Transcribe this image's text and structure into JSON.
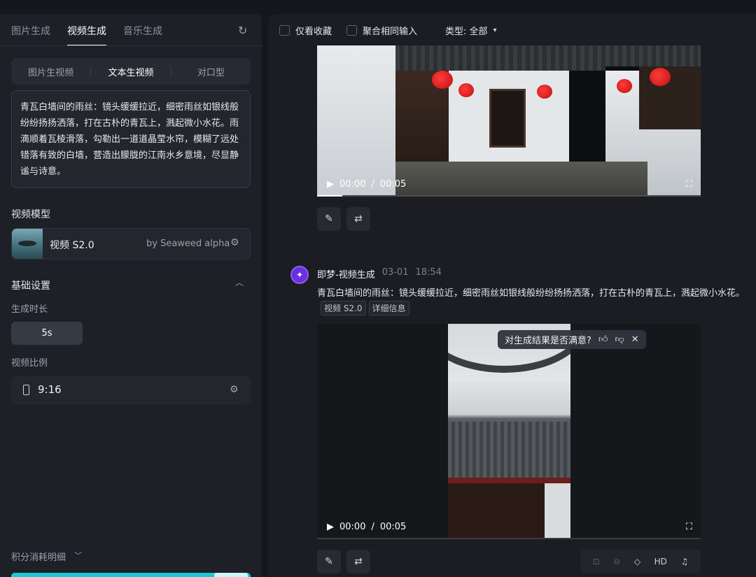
{
  "left_panel": {
    "tabs": [
      "图片生成",
      "视频生成",
      "音乐生成"
    ],
    "active_tab": "视频生成",
    "modes": [
      "图片生视频",
      "文本生视频",
      "对口型"
    ],
    "active_mode": "文本生视频",
    "prompt": "青瓦白墙间的雨丝：镜头缓缓拉近，细密雨丝如银线般纷纷扬扬洒落，打在古朴的青瓦上，溅起微小水花。雨滴顺着瓦棱滑落，勾勒出一道道晶莹水帘，模糊了远处错落有致的白墙，营造出朦胧的江南水乡意境，尽显静谧与诗意。",
    "model_section_title": "视频模型",
    "model_name": "视频 S2.0",
    "model_by": "by Seaweed alpha",
    "basic_settings_title": "基础设置",
    "duration_label": "生成时长",
    "duration_value": "5s",
    "ratio_label": "视频比例",
    "ratio_value": "9:16",
    "credits_label": "积分消耗明细"
  },
  "filters": {
    "favorites_only": "仅看收藏",
    "merge_same_input": "聚合相同输入",
    "type_label": "类型: 全部"
  },
  "video1": {
    "current_time": "00:00",
    "separator": "/",
    "duration": "00:05"
  },
  "entry2": {
    "author": "即梦-视频生成",
    "date": "03-01",
    "time": "18:54",
    "prompt_preview": "青瓦白墙间的雨丝：镜头缓缓拉近，细密雨丝如银线般纷纷扬扬洒落，打在古朴的青瓦上，溅起微小水花。",
    "badges": [
      "视频 S2.0",
      "详细信息"
    ],
    "feedback_question": "对生成结果是否满意?",
    "current_time": "00:00",
    "separator": "/",
    "duration": "00:05"
  },
  "tools": {
    "hd_label": "HD"
  },
  "icons": {
    "refresh": "refresh-icon",
    "edit": "pencil-icon",
    "regenerate": "repeat-icon",
    "play": "play-icon",
    "fullscreen": "fullscreen-icon",
    "thumbs_up": "thumbs-up-icon",
    "thumbs_down": "thumbs-down-icon",
    "close": "close-icon",
    "music": "music-icon"
  },
  "colors": {
    "accent_cyan": "#1cc7d8",
    "avatar_purple": "#6a2fe0",
    "lantern_red": "#d61717"
  }
}
